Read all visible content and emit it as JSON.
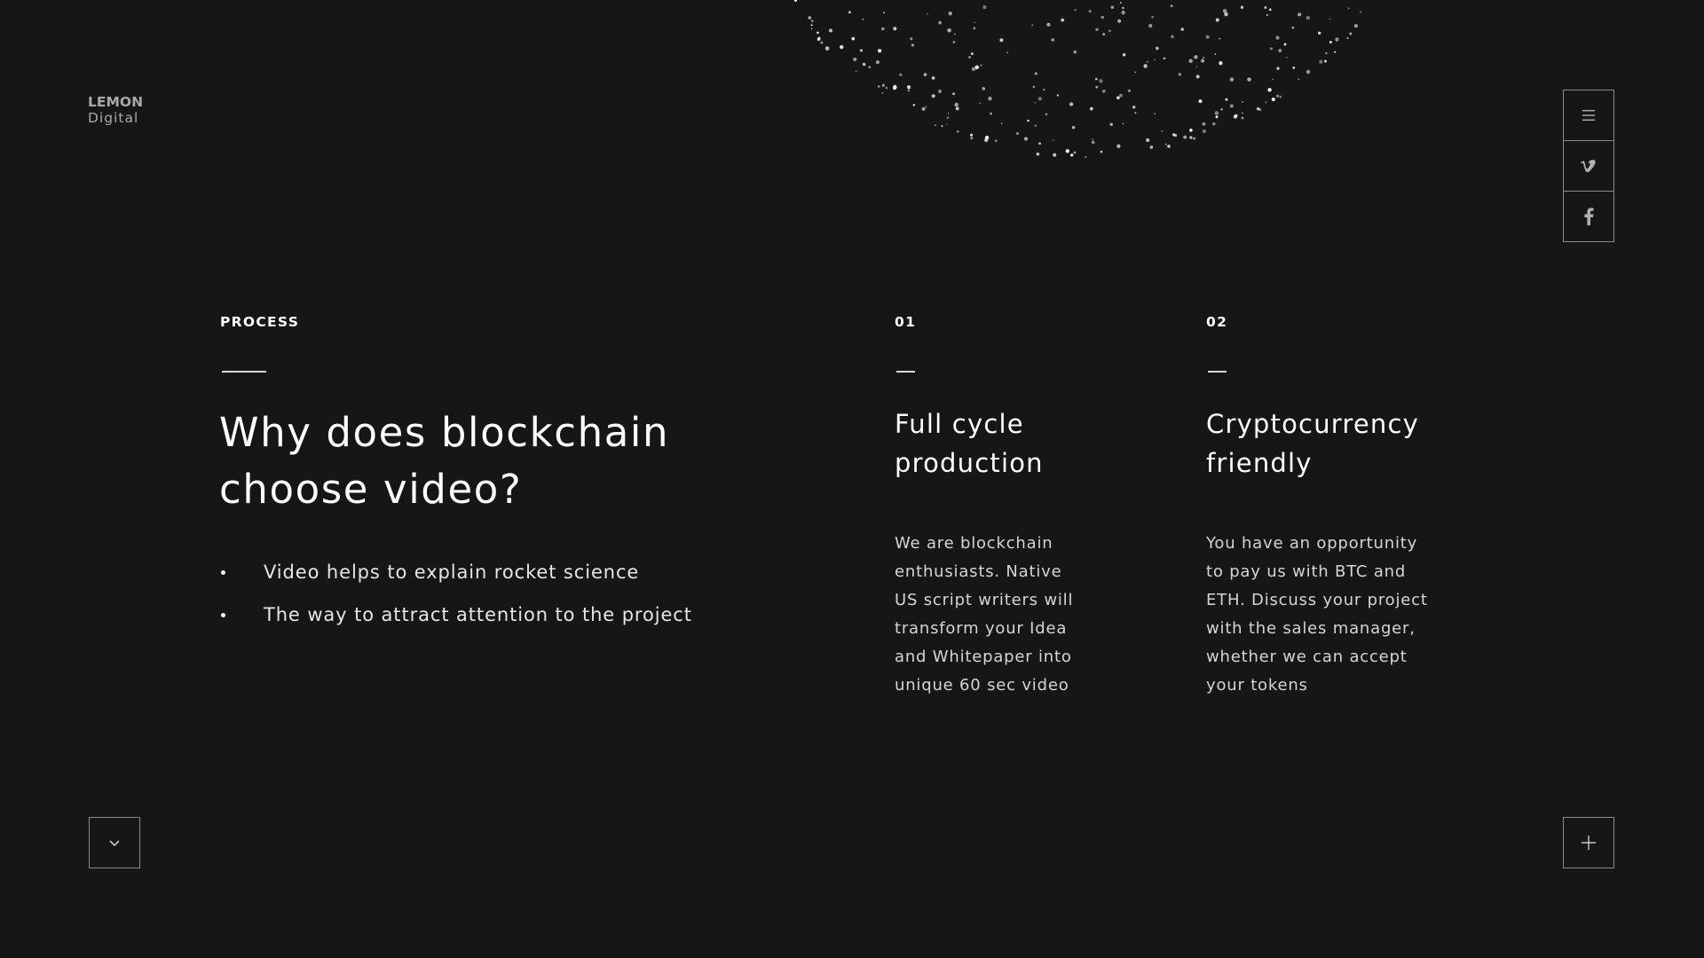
{
  "brand": {
    "logo_line1": "LEMON",
    "logo_line2": "Digital"
  },
  "side_nav": {
    "icons": [
      "menu-icon",
      "vimeo-icon",
      "facebook-icon"
    ]
  },
  "process": {
    "label": "PROCESS",
    "headline_line1": "Why does blockchain",
    "headline_line2": "choose video?",
    "bullets": [
      "Video helps to explain rocket science",
      "The way to attract attention to the project"
    ]
  },
  "columns": [
    {
      "number": "01",
      "title_line1": "Full cycle",
      "title_line2": "production",
      "text_lines": [
        "We are blockchain",
        "enthusiasts. Native",
        "US script writers will",
        "transform your Idea",
        "and Whitepaper into",
        "unique 60 sec video"
      ]
    },
    {
      "number": "02",
      "title_line1": "Cryptocurrency",
      "title_line2": "friendly",
      "text_lines": [
        "You have an opportunity",
        "to pay us with BTC and",
        "ETH. Discuss your project",
        "with the sales manager,",
        "whether we can accept",
        "your tokens"
      ]
    }
  ],
  "bottom": {
    "left_icon": "chevron-down-icon",
    "right_icon": "plus-icon"
  },
  "colors": {
    "background": "#161616",
    "text": "#ffffff",
    "muted": "#a9a9a9",
    "border": "#8a8a8a"
  }
}
